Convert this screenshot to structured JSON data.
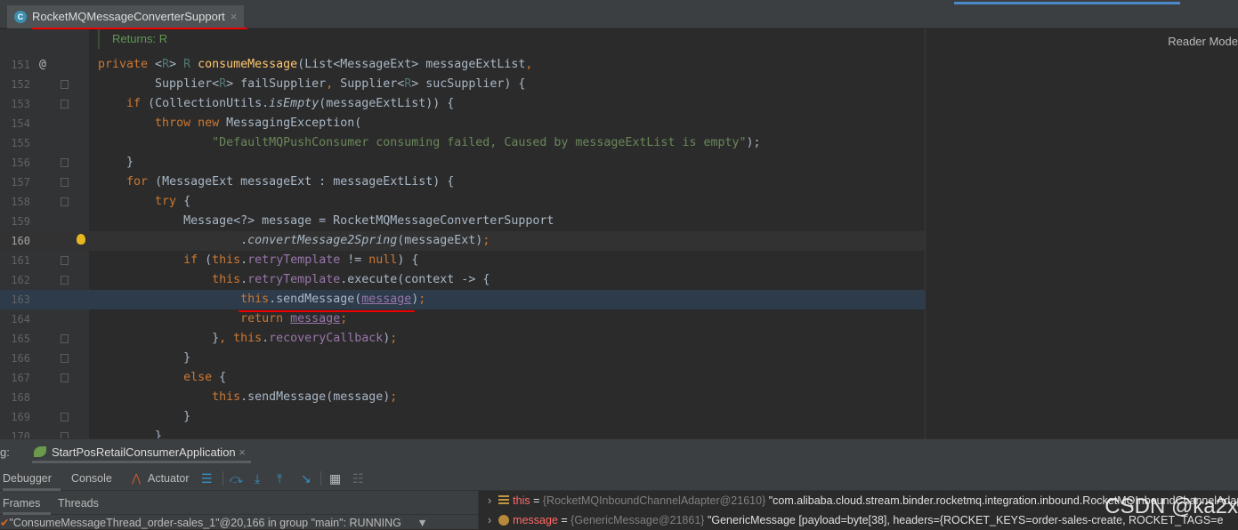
{
  "editor_tab": {
    "title": "RocketMQMessageConverterSupport",
    "icon": "class-icon",
    "close": "×"
  },
  "reader_mode": "Reader Mode",
  "doc_comment": "Returns: R",
  "lines": [
    {
      "n": "151",
      "marker": "@",
      "tokens": [
        [
          "private ",
          "k"
        ],
        [
          "<",
          "t"
        ],
        [
          "R",
          "g"
        ],
        [
          "> ",
          "t"
        ],
        [
          "R ",
          "g"
        ],
        [
          "consumeMessage",
          "m"
        ],
        [
          "(List<MessageExt> messageExtList",
          "t"
        ],
        [
          ",",
          "k"
        ]
      ]
    },
    {
      "n": "152",
      "fold": true,
      "tokens": [
        [
          "        Supplier<",
          "t"
        ],
        [
          "R",
          "g"
        ],
        [
          "> failSupplier",
          "t"
        ],
        [
          ", ",
          "k"
        ],
        [
          "Supplier<",
          "t"
        ],
        [
          "R",
          "g"
        ],
        [
          "> sucSupplier) {",
          "t"
        ]
      ]
    },
    {
      "n": "153",
      "fold": true,
      "tokens": [
        [
          "    ",
          "t"
        ],
        [
          "if ",
          "k"
        ],
        [
          "(CollectionUtils.",
          "t"
        ],
        [
          "isEmpty",
          "i"
        ],
        [
          "(messageExtList)) {",
          "t"
        ]
      ]
    },
    {
      "n": "154",
      "tokens": [
        [
          "        ",
          "t"
        ],
        [
          "throw new ",
          "k"
        ],
        [
          "MessagingException(",
          "t"
        ]
      ]
    },
    {
      "n": "155",
      "tokens": [
        [
          "                ",
          "t"
        ],
        [
          "\"DefaultMQPushConsumer consuming failed, Caused by messageExtList is empty\"",
          "s"
        ],
        [
          ");",
          "t"
        ]
      ]
    },
    {
      "n": "156",
      "fold": true,
      "tokens": [
        [
          "    }",
          "t"
        ]
      ]
    },
    {
      "n": "157",
      "fold": true,
      "tokens": [
        [
          "    ",
          "t"
        ],
        [
          "for ",
          "k"
        ],
        [
          "(MessageExt messageExt : messageExtList) {",
          "t"
        ]
      ]
    },
    {
      "n": "158",
      "fold": true,
      "tokens": [
        [
          "        ",
          "t"
        ],
        [
          "try ",
          "k"
        ],
        [
          "{",
          "t"
        ]
      ]
    },
    {
      "n": "159",
      "tokens": [
        [
          "            Message<?> message = RocketMQMessageConverterSupport",
          "t"
        ]
      ]
    },
    {
      "n": "160",
      "current": true,
      "bulb": true,
      "tokens": [
        [
          "                    .",
          "t"
        ],
        [
          "convertMessage2Spring",
          "i"
        ],
        [
          "(messageExt)",
          "t"
        ],
        [
          ";",
          "k"
        ]
      ]
    },
    {
      "n": "161",
      "fold": true,
      "tokens": [
        [
          "            ",
          "t"
        ],
        [
          "if ",
          "k"
        ],
        [
          "(",
          "t"
        ],
        [
          "this",
          "k"
        ],
        [
          ".",
          "t"
        ],
        [
          "retryTemplate ",
          "f"
        ],
        [
          "!= ",
          "t"
        ],
        [
          "null",
          "k"
        ],
        [
          ") {",
          "t"
        ]
      ]
    },
    {
      "n": "162",
      "fold": true,
      "tokens": [
        [
          "                ",
          "t"
        ],
        [
          "this",
          "k"
        ],
        [
          ".",
          "t"
        ],
        [
          "retryTemplate",
          "f"
        ],
        [
          ".execute(context -> {",
          "t"
        ]
      ]
    },
    {
      "n": "163",
      "selected": true,
      "tokens": [
        [
          "                    ",
          "t"
        ],
        [
          "this",
          "k"
        ],
        [
          ".sendMessage(",
          "t"
        ],
        [
          "message",
          "fu"
        ],
        [
          ")",
          "t"
        ],
        [
          ";",
          "k"
        ]
      ]
    },
    {
      "n": "164",
      "tokens": [
        [
          "                    ",
          "t"
        ],
        [
          "return ",
          "k"
        ],
        [
          "message",
          "fu"
        ],
        [
          ";",
          "k"
        ]
      ]
    },
    {
      "n": "165",
      "fold": true,
      "tokens": [
        [
          "                }",
          "t"
        ],
        [
          ", ",
          "k"
        ],
        [
          "this",
          "k"
        ],
        [
          ".",
          "t"
        ],
        [
          "recoveryCallback",
          "f"
        ],
        [
          ")",
          "t"
        ],
        [
          ";",
          "k"
        ]
      ]
    },
    {
      "n": "166",
      "fold": true,
      "tokens": [
        [
          "            }",
          "t"
        ]
      ]
    },
    {
      "n": "167",
      "fold": true,
      "tokens": [
        [
          "            ",
          "t"
        ],
        [
          "else ",
          "k"
        ],
        [
          "{",
          "t"
        ]
      ]
    },
    {
      "n": "168",
      "tokens": [
        [
          "                ",
          "t"
        ],
        [
          "this",
          "k"
        ],
        [
          ".sendMessage(message)",
          "t"
        ],
        [
          ";",
          "k"
        ]
      ]
    },
    {
      "n": "169",
      "fold": true,
      "tokens": [
        [
          "            }",
          "t"
        ]
      ]
    },
    {
      "n": "170",
      "fold": true,
      "tokens": [
        [
          "        }",
          "t"
        ]
      ]
    }
  ],
  "debug": {
    "label": "g:",
    "run_config": "StartPosRetailConsumerApplication",
    "tabs": [
      "Debugger",
      "Console",
      "Actuator"
    ],
    "subtabs": [
      "Frames",
      "Threads"
    ],
    "thread": "\"ConsumeMessageThread_order-sales_1\"@20,166 in group \"main\": RUNNING",
    "variables": [
      {
        "icon": "field-icon",
        "name": "this",
        "type": "{RocketMQInboundChannelAdapter@21610}",
        "value": "\"com.alibaba.cloud.stream.binder.rocketmq.integration.inbound.RocketMQInboundChannelAdapter"
      },
      {
        "icon": "parameter-icon",
        "name": "message",
        "type": "{GenericMessage@21861}",
        "value": "\"GenericMessage [payload=byte[38], headers={ROCKET_KEYS=order-sales-create, ROCKET_TAGS=e"
      }
    ]
  },
  "watermark": "CSDN @ka2x",
  "colors": {
    "keyword": "#cc7832",
    "method": "#ffc66d",
    "string": "#6a8759",
    "field": "#9876aa",
    "annotation_red": "#e00000"
  }
}
